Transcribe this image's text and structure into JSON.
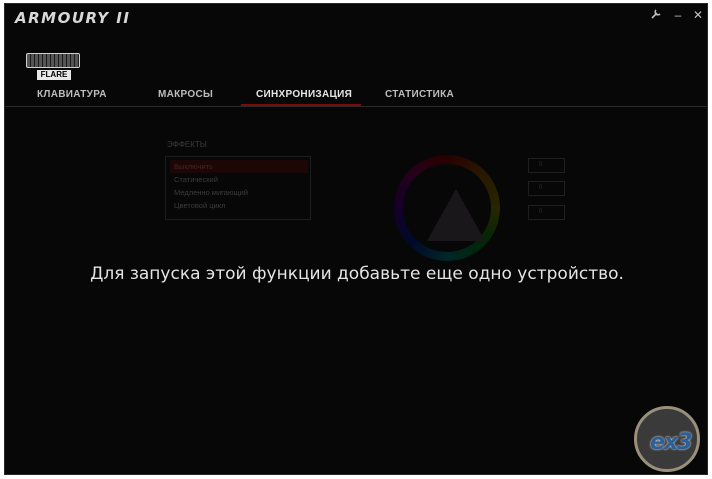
{
  "app": {
    "title": "ARMOURY II"
  },
  "window_controls": {
    "settings_icon": "wrench-icon",
    "minimize": "–",
    "close": "✕"
  },
  "device": {
    "label": "FLARE",
    "icon": "keyboard-icon"
  },
  "tabs": [
    {
      "label": "КЛАВИАТУРА"
    },
    {
      "label": "МАКРОСЫ"
    },
    {
      "label": "СИНХРОНИЗАЦИЯ"
    },
    {
      "label": "СТАТИСТИКА"
    }
  ],
  "effects": {
    "title": "ЭФФЕКТЫ",
    "items": [
      "Выключить",
      "Статический",
      "Медленно мигающий",
      "Цветовой цикл"
    ],
    "selected": "Выключить"
  },
  "rgb": {
    "values": [
      "0",
      "0",
      "0"
    ]
  },
  "notice": "Для запуска этой функции добавьте еще одно устройство.",
  "watermark": {
    "text": "ex3"
  },
  "colors": {
    "background": "#070707",
    "accent": "#7a0b0b",
    "text": "#e4e4e4"
  }
}
